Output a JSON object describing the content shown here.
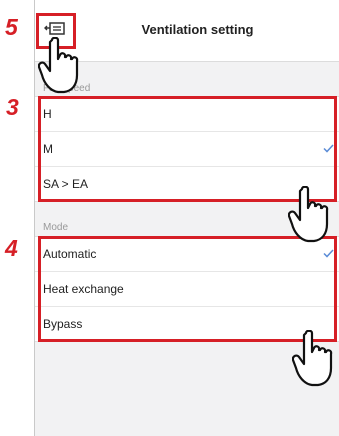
{
  "header": {
    "title": "Ventilation setting",
    "back_icon": "screen-back-icon"
  },
  "fan_speed": {
    "section_label": "Fan speed",
    "items": [
      {
        "label": "H",
        "selected": false
      },
      {
        "label": "M",
        "selected": true
      },
      {
        "label": "SA > EA",
        "selected": false
      }
    ]
  },
  "mode": {
    "section_label": "Mode",
    "items": [
      {
        "label": "Automatic",
        "selected": true
      },
      {
        "label": "Heat exchange",
        "selected": false
      },
      {
        "label": "Bypass",
        "selected": false
      }
    ]
  },
  "callouts": {
    "back": "5",
    "fan_speed": "3",
    "mode": "4"
  },
  "colors": {
    "accent": "#d61f26",
    "check": "#5a8bd6",
    "background": "#f2f2f3"
  }
}
